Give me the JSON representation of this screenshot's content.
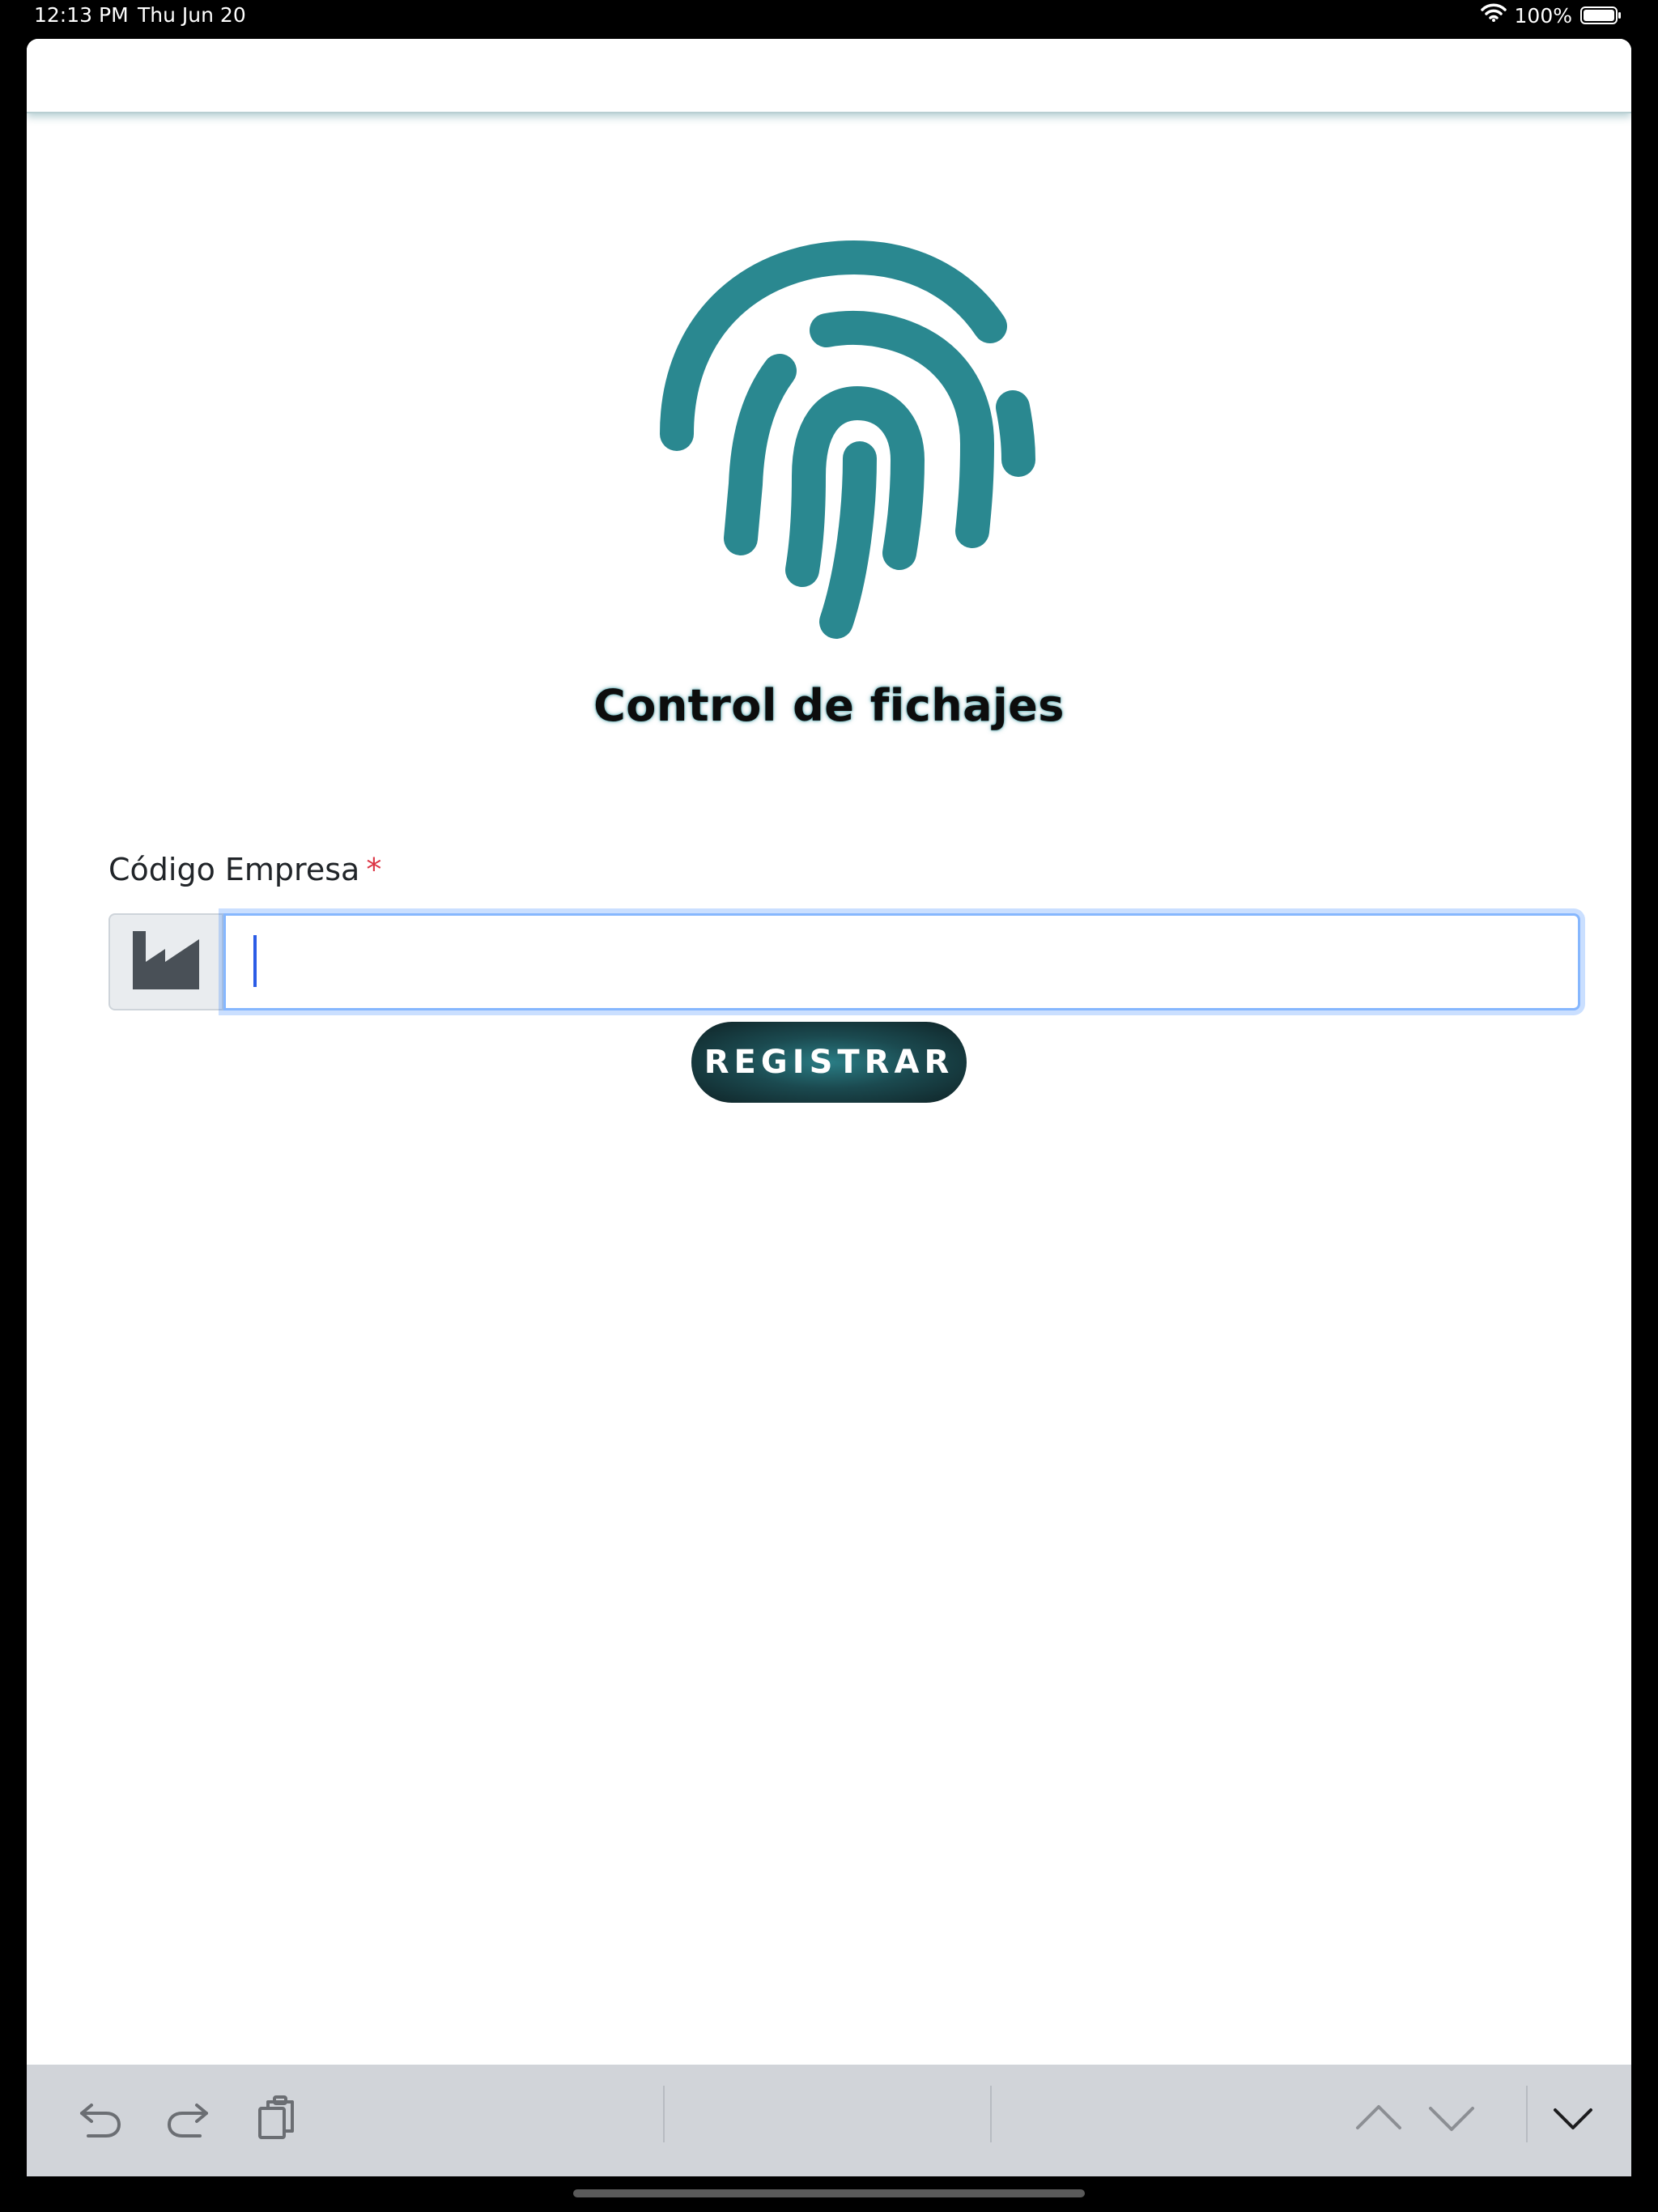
{
  "status_bar": {
    "time": "12:13 PM",
    "date": "Thu Jun 20",
    "battery": "100%",
    "icons": [
      "wifi-icon",
      "battery-icon"
    ]
  },
  "app": {
    "title": "Control de fichajes",
    "logo_icon": "fingerprint-icon",
    "brand_color": "#2a8890"
  },
  "form": {
    "company_code": {
      "label": "Código Empresa",
      "required_mark": "*",
      "value": "",
      "placeholder": "",
      "addon_icon": "factory-icon"
    },
    "submit_label": "REGISTRAR"
  },
  "keyboard_accessory": {
    "left_icons": [
      "undo-icon",
      "redo-icon",
      "paste-icon"
    ],
    "right_icons": [
      "chevron-up-icon",
      "chevron-down-icon",
      "dismiss-keyboard-icon"
    ]
  }
}
